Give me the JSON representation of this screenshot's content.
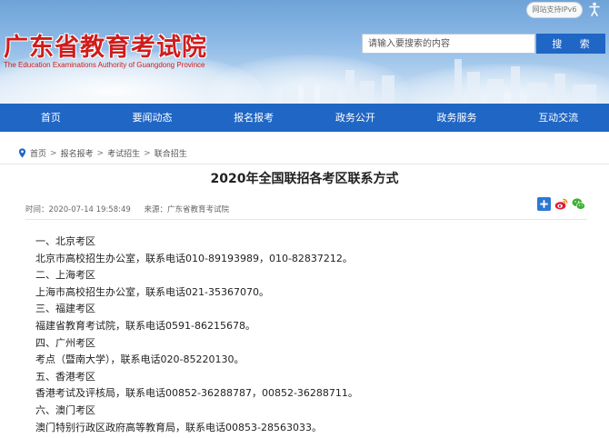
{
  "header": {
    "site_title": "广东省教育考试院",
    "site_subtitle": "The Education Examinations Authority of Guangdong Province",
    "ipv6_badge": "网站支持IPv6",
    "search_placeholder": "请输入要搜索的内容",
    "search_button": "搜 索"
  },
  "nav": {
    "items": [
      "首页",
      "要闻动态",
      "报名报考",
      "政务公开",
      "政务服务",
      "互动交流"
    ]
  },
  "breadcrumb": [
    "首页",
    "报名报考",
    "考试招生",
    "联合招生"
  ],
  "article": {
    "title": "2020年全国联招各考区联系方式",
    "time": "时间：2020-07-14 19:58:49",
    "source": "来源：广东省教育考试院",
    "lines": [
      "一、北京考区",
      "北京市高校招生办公室，联系电话010-89193989，010-82837212。",
      "二、上海考区",
      "上海市高校招生办公室，联系电话021-35367070。",
      "三、福建考区",
      "福建省教育考试院，联系电话0591-86215678。",
      "四、广州考区",
      "考点（暨南大学），联系电话020-85220130。",
      "五、香港考区",
      "香港考试及评核局，联系电话00852-36288787，00852-36288711。",
      "六、澳门考区",
      "澳门特别行政区政府高等教育局，联系电话00853-28563033。"
    ]
  },
  "colors": {
    "brand_red": "#cf1c1c",
    "nav_blue": "#1f66c5",
    "sky_blue": "#8cb9e6"
  },
  "icons": [
    "accessibility-icon",
    "location-pin-icon",
    "share-plus-icon",
    "weibo-icon",
    "wechat-icon"
  ]
}
